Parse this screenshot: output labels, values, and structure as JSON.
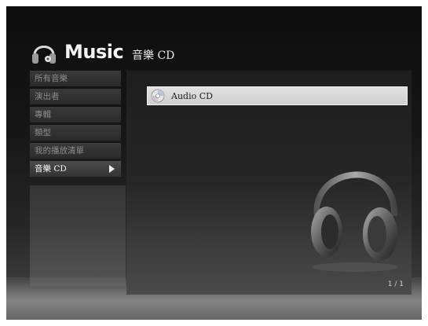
{
  "app": {
    "title": "Music",
    "section_title": "音樂 CD"
  },
  "menu": {
    "items": [
      {
        "label": "所有音樂"
      },
      {
        "label": "演出者"
      },
      {
        "label": "專輯"
      },
      {
        "label": "類型"
      },
      {
        "label": "我的播放清單"
      },
      {
        "label": "音樂 CD",
        "selected": true
      }
    ]
  },
  "content": {
    "items": [
      {
        "label": "Audio CD",
        "icon": "cd-icon"
      }
    ],
    "page_indicator": "1 / 1"
  },
  "colors": {
    "background": "#161616",
    "highlight_row": "#d8d8d8",
    "menu_item": "#2f2f2f"
  }
}
